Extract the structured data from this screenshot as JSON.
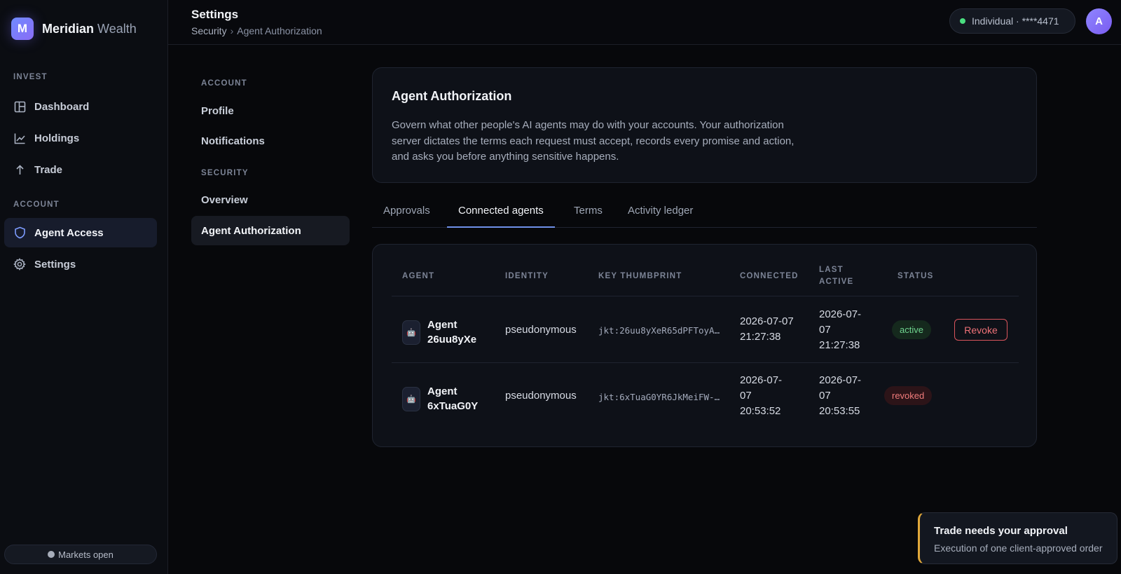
{
  "brand": {
    "logo_letter": "M",
    "name": "Meridian",
    "name_suffix": "Wealth"
  },
  "sidebar": {
    "sections": [
      {
        "title": "INVEST"
      },
      {
        "title": "ACCOUNT"
      }
    ],
    "items": [
      {
        "label": "Dashboard",
        "icon": "dashboard-icon"
      },
      {
        "label": "Holdings",
        "icon": "chart-line-icon"
      },
      {
        "label": "Trade",
        "icon": "arrow-up-icon"
      },
      {
        "label": "Agent Access",
        "icon": "shield-icon",
        "active": true
      },
      {
        "label": "Settings",
        "icon": "gear-icon"
      }
    ],
    "markets_status": "Markets open"
  },
  "header": {
    "title": "Settings",
    "breadcrumb": [
      "Security",
      "Agent Authorization"
    ],
    "breadcrumb_sep": "›",
    "account": "Individual · ****4471",
    "avatar_letter": "A"
  },
  "settings_nav": {
    "sections": [
      {
        "title": "ACCOUNT",
        "items": [
          "Profile",
          "Notifications"
        ]
      },
      {
        "title": "SECURITY",
        "items": [
          "Overview",
          "Agent Authorization"
        ]
      }
    ],
    "active_item": "Agent Authorization"
  },
  "intro": {
    "title": "Agent Authorization",
    "body": "Govern what other people's AI agents may do with your accounts. Your authorization server dictates the terms each request must accept, records every promise and action, and asks you before anything sensitive happens."
  },
  "tabs": [
    {
      "label": "Approvals"
    },
    {
      "label": "Connected agents",
      "active": true
    },
    {
      "label": "Terms"
    },
    {
      "label": "Activity ledger"
    }
  ],
  "table": {
    "columns": [
      "AGENT",
      "IDENTITY",
      "KEY THUMBPRINT",
      "CONNECTED",
      "LAST ACTIVE",
      "STATUS"
    ],
    "rows": [
      {
        "agent": "Agent 26uu8yXe",
        "identity": "pseudonymous",
        "thumbprint": "jkt:26uu8yXeR65dPFToyA…",
        "connected": "2026-07-07 21:27:38",
        "last_active": "2026-07-07 21:27:38",
        "status": "active",
        "action": "Revoke"
      },
      {
        "agent": "Agent 6xTuaG0Y",
        "identity": "pseudonymous",
        "thumbprint": "jkt:6xTuaG0YR6JkMeiFW-…",
        "connected": "2026-07-07 20:53:52",
        "last_active": "2026-07-07 20:53:55",
        "status": "revoked",
        "action": ""
      }
    ]
  },
  "toast": {
    "title": "Trade needs your approval",
    "text": "Execution of one client-approved order",
    "accent": "#e1a83a"
  },
  "colors": {
    "accent": "#6f8fe8",
    "success": "#6fd48f",
    "danger": "#ef7278",
    "background": "#07080b"
  }
}
